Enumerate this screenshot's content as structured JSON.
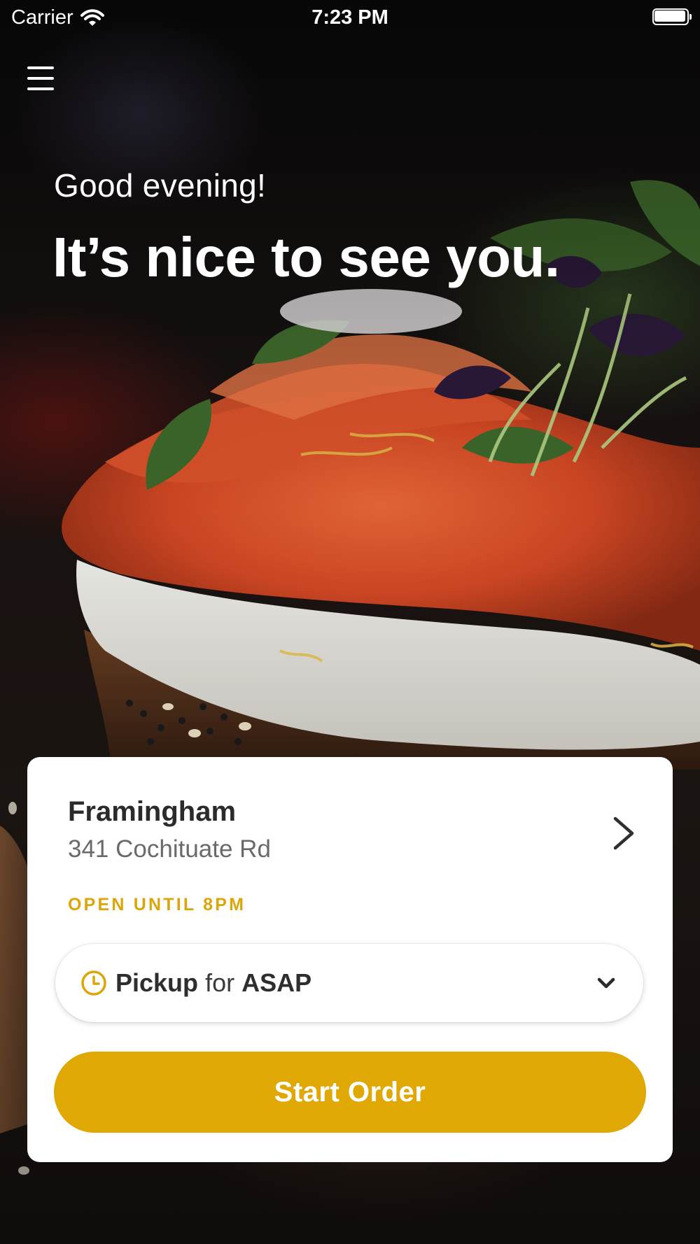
{
  "status_bar": {
    "carrier": "Carrier",
    "time": "7:23 PM",
    "icons": [
      "wifi-icon",
      "battery-icon"
    ]
  },
  "header": {
    "menu_icon": "hamburger-menu-icon",
    "greeting": "Good evening!",
    "headline": "It’s nice to see you."
  },
  "store_card": {
    "name": "Framingham",
    "address": "341 Cochituate Rd",
    "hours": "OPEN UNTIL 8PM",
    "chevron_icon": "chevron-right-icon",
    "order_mode": {
      "icon": "clock-icon",
      "method": "Pickup",
      "connector": "for",
      "time": "ASAP",
      "dropdown_icon": "chevron-down-icon"
    },
    "start_button_label": "Start Order"
  },
  "colors": {
    "accent": "#E0A805",
    "hours_text": "#DCA50A",
    "card_background": "#FFFFFF",
    "primary_text": "#2B2B2B",
    "secondary_text": "#6A6A6A"
  }
}
